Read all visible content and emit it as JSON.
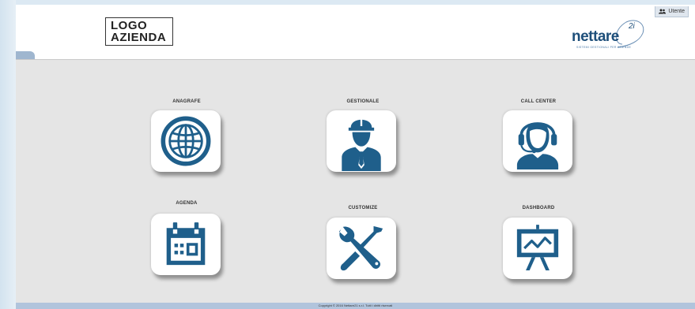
{
  "header": {
    "logo_line1": "LOGO",
    "logo_line2": "AZIENDA",
    "brand_name": "nettare",
    "brand_superscript": "2i",
    "brand_tagline": "SISTEMI GESTIONALI PER AZIENDE",
    "user_label": "Utente"
  },
  "tiles": [
    {
      "label": "ANAGRAFE",
      "icon": "globe-icon"
    },
    {
      "label": "GESTIONALE",
      "icon": "worker-icon"
    },
    {
      "label": "CALL CENTER",
      "icon": "headset-operator-icon"
    },
    {
      "label": "AGENDA",
      "icon": "calendar-icon"
    },
    {
      "label": "CUSTOMIZE",
      "icon": "tools-icon"
    },
    {
      "label": "DASHBOARD",
      "icon": "presentation-chart-icon"
    }
  ],
  "footer": {
    "text": "Copyright © 2016 Nettare21 s.r.l. Tutti i diritti riservati"
  },
  "colors": {
    "icon": "#1f5f8b",
    "background": "#e5e5e5",
    "footer": "#b1c4dc"
  }
}
